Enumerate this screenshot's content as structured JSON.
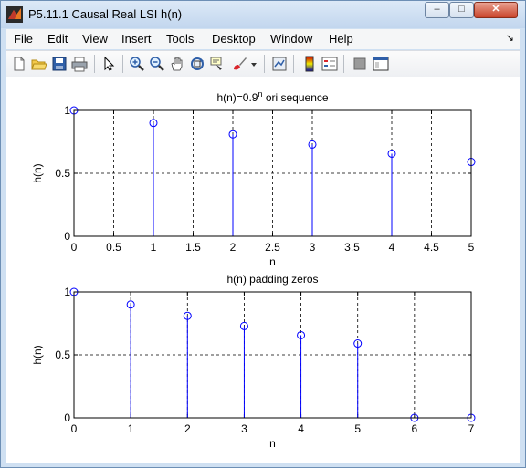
{
  "window": {
    "title": "P5.11.1 Causal Real LSI h(n)",
    "min_glyph": "–",
    "max_glyph": "□",
    "close_glyph": "✕"
  },
  "menu": {
    "items": [
      "File",
      "Edit",
      "View",
      "Insert",
      "Tools",
      "Desktop",
      "Window",
      "Help"
    ],
    "overflow_glyph": "↘"
  },
  "toolbar": {
    "icons": [
      "new-figure-icon",
      "open-file-icon",
      "save-icon",
      "print-icon",
      "select-arrow-icon",
      "zoom-in-icon",
      "zoom-out-icon",
      "pan-hand-icon",
      "rotate-3d-icon",
      "data-cursor-icon",
      "brush-icon",
      "brush-dropdown-icon",
      "link-plot-icon",
      "colorbar-icon",
      "legend-icon",
      "hide-plot-tools-icon",
      "show-plot-tools-icon"
    ]
  },
  "chart_data": [
    {
      "type": "stem",
      "title_base": "h(n)=0.9",
      "title_sup": "n",
      "title_rest": " ori sequence",
      "xlabel": "n",
      "ylabel": "h(n)",
      "x": [
        0,
        1,
        2,
        3,
        4,
        5
      ],
      "values": [
        1,
        0.9,
        0.81,
        0.729,
        0.6561,
        0.5905
      ],
      "xlim": [
        0,
        5
      ],
      "ylim": [
        0,
        1
      ],
      "xticks": [
        "0",
        "0.5",
        "1",
        "1.5",
        "2",
        "2.5",
        "3",
        "3.5",
        "4",
        "4.5",
        "5"
      ],
      "xtick_values": [
        0,
        0.5,
        1,
        1.5,
        2,
        2.5,
        3,
        3.5,
        4,
        4.5,
        5
      ],
      "yticks": [
        "0",
        "0.5",
        "1"
      ],
      "ytick_values": [
        0,
        0.5,
        1
      ],
      "grid": true,
      "color": "#0000ff"
    },
    {
      "type": "stem",
      "title_base": "h(n) padding zeros",
      "title_sup": "",
      "title_rest": "",
      "xlabel": "n",
      "ylabel": "h(n)",
      "x": [
        0,
        1,
        2,
        3,
        4,
        5,
        6,
        7
      ],
      "values": [
        1,
        0.9,
        0.81,
        0.729,
        0.6561,
        0.5905,
        0,
        0
      ],
      "xlim": [
        0,
        7
      ],
      "ylim": [
        0,
        1
      ],
      "xticks": [
        "0",
        "1",
        "2",
        "3",
        "4",
        "5",
        "6",
        "7"
      ],
      "xtick_values": [
        0,
        1,
        2,
        3,
        4,
        5,
        6,
        7
      ],
      "yticks": [
        "0",
        "0.5",
        "1"
      ],
      "ytick_values": [
        0,
        0.5,
        1
      ],
      "grid": true,
      "color": "#0000ff"
    }
  ]
}
